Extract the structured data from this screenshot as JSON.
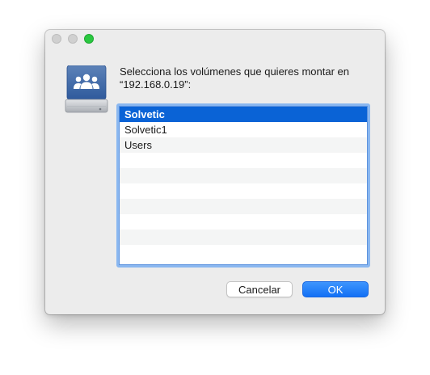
{
  "window": {
    "traffic_lights": {
      "close": "close-button",
      "minimize": "minimize-button",
      "zoom": "zoom-button",
      "zoom_color": "#2ac840"
    }
  },
  "dialog": {
    "icon": "shared-server-drive-icon",
    "message_line1": "Selecciona los volúmenes que quieres montar en",
    "message_line2": "“192.168.0.19”:"
  },
  "volumes": {
    "items": [
      "Solvetic",
      "Solvetic1",
      "Users"
    ],
    "selected": "Solvetic",
    "selection_color": "#0a63d6",
    "empty_rows": 7
  },
  "buttons": {
    "cancel_label": "Cancelar",
    "ok_label": "OK",
    "ok_color": "#1270f5"
  }
}
